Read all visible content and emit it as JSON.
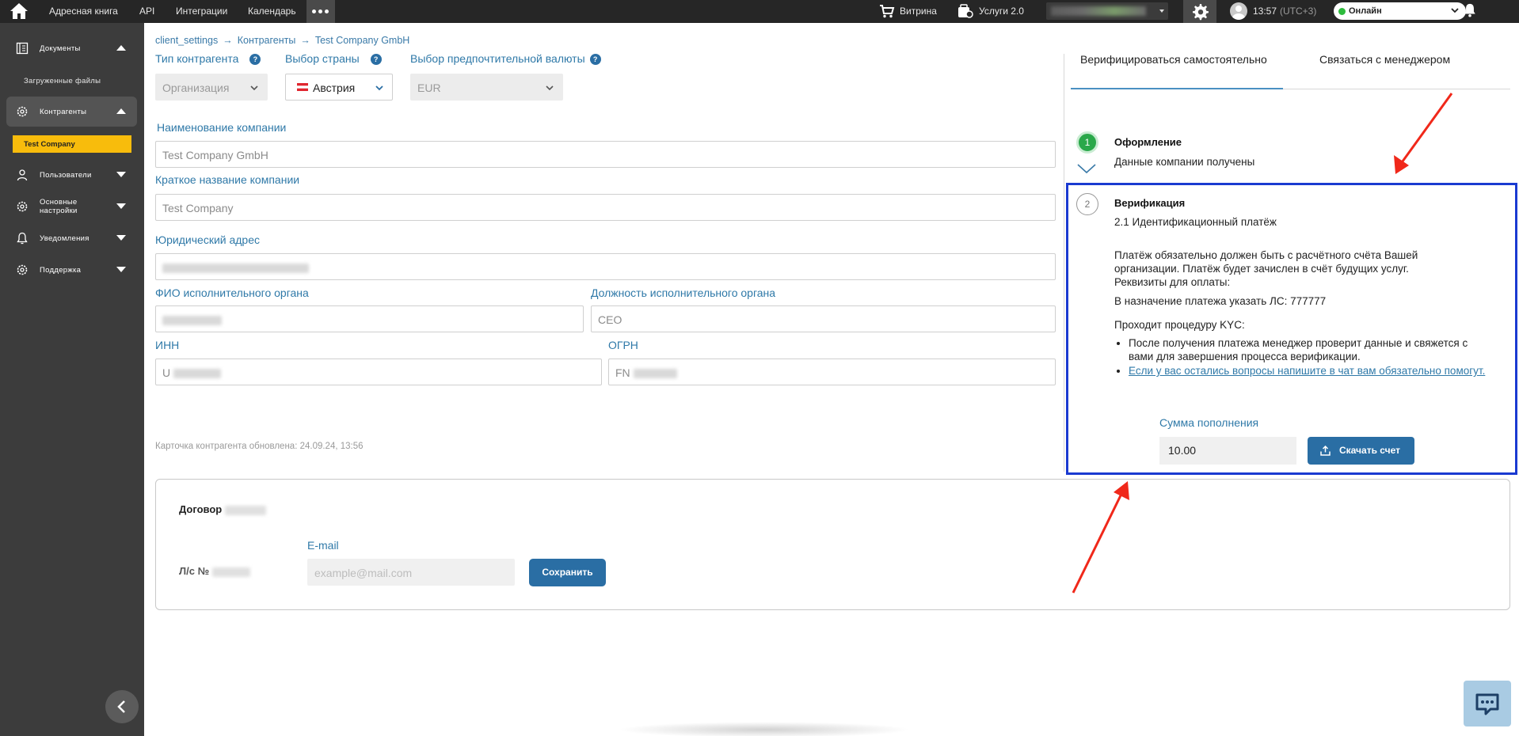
{
  "topbar": {
    "nav": [
      "Адресная книга",
      "API",
      "Интеграции",
      "Календарь"
    ],
    "showcase": "Витрина",
    "services": "Услуги 2.0",
    "time": "13:57",
    "tz": "(UTC+3)",
    "status": "Онлайн",
    "status_color": "#2dbb3c",
    "icons": [
      "home-icon",
      "more-icon",
      "cart-icon",
      "services-icon",
      "gear-icon",
      "avatar",
      "bell-icon"
    ]
  },
  "sidebar": {
    "documents": "Документы",
    "uploaded_files": "Загруженные файлы",
    "counterparties": "Контрагенты",
    "selected_company": "Test Company",
    "users": "Пользователи",
    "settings_line1": "Основные",
    "settings_line2": "настройки",
    "notifications": "Уведомления",
    "support": "Поддержка"
  },
  "breadcrumb": [
    "client_settings",
    "Контрагенты",
    "Test Company GmbH"
  ],
  "form": {
    "type_label": "Тип контрагента",
    "type_value": "Организация",
    "country_label": "Выбор страны",
    "country_value": "Австрия",
    "currency_label": "Выбор предпочтительной валюты",
    "currency_value": "EUR",
    "company_name_label": "Наименование компании",
    "company_name_value": "Test Company GmbH",
    "short_name_label": "Краткое название компании",
    "short_name_value": "Test Company",
    "address_label": "Юридический адрес",
    "exec_name_label": "ФИО исполнительного органа",
    "exec_position_label": "Должность исполнительного органа",
    "exec_position_value": "CEO",
    "inn_label": "ИНН",
    "inn_prefix": "U",
    "ogrn_label": "ОГРН",
    "ogrn_prefix": "FN",
    "updated_text": "Карточка контрагента обновлена: 24.09.24, 13:56"
  },
  "contract": {
    "title": "Договор",
    "account_label": "Л/с №",
    "email_label": "E-mail",
    "email_placeholder": "example@mail.com",
    "save_button": "Сохранить"
  },
  "verification": {
    "tab_self": "Верифицироваться самостоятельно",
    "tab_manager": "Связаться с менеджером",
    "step1_number": "1",
    "step1_title": "Оформление",
    "step1_text": "Данные компании получены",
    "step2_number": "2",
    "step2_title": "Верификация",
    "step2_subtitle": "2.1 Идентификационный платёж",
    "payment_p1": "Платёж обязательно должен быть с расчётного счёта Вашей",
    "payment_p2": "организации. Платёж будет зачислен в счёт будущих услуг.",
    "payment_p3": "Реквизиты для оплаты:",
    "purpose": "В назначение платежа указать ЛС: 777777",
    "kyc": "Проходит процедуру KYC:",
    "bullet1": "После получения платежа менеджер проверит данные и свяжется с вами для завершения процесса верификации.",
    "bullet2": "Если у вас остались вопросы напишите в чат вам обязательно помогут.",
    "amount_label": "Сумма пополнения",
    "amount_value": "10.00",
    "download_button": "Скачать счет"
  },
  "colors": {
    "accent": "#2a6ea4",
    "highlight_box": "#1a3ad1",
    "annotation_arrow": "#f0281a",
    "selected_item": "#f8bc0c"
  }
}
